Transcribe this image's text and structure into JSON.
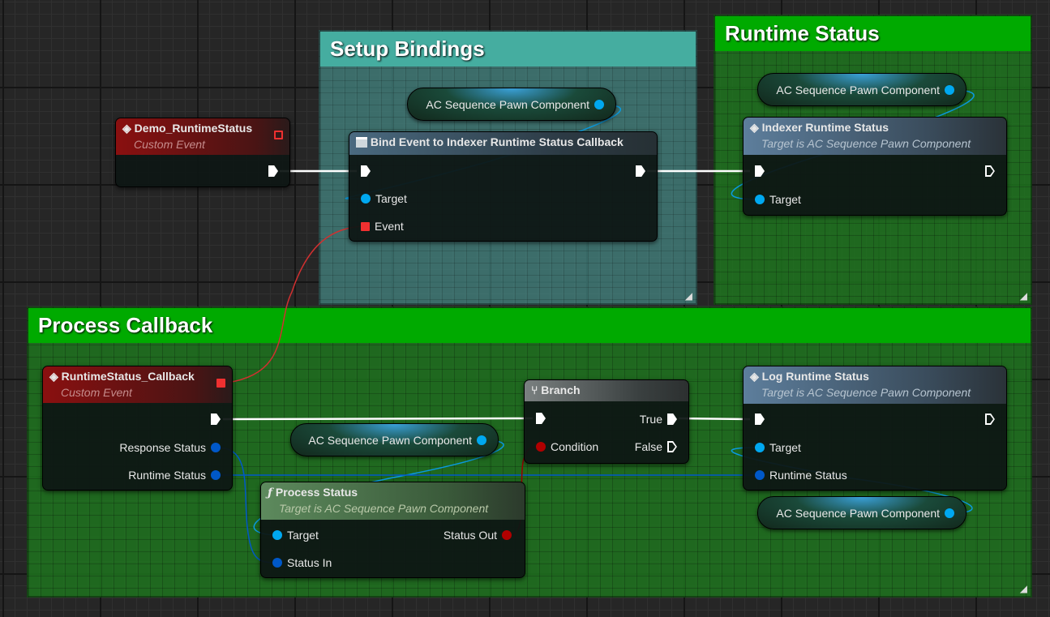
{
  "comments": {
    "setup": "Setup Bindings",
    "runtime": "Runtime Status",
    "process": "Process Callback"
  },
  "nodes": {
    "demo_event": {
      "title": "Demo_RuntimeStatus",
      "subtitle": "Custom Event"
    },
    "bind_event": {
      "title": "Bind Event to Indexer Runtime Status Callback",
      "target": "Target",
      "event": "Event"
    },
    "indexer_status": {
      "title": "Indexer Runtime Status",
      "subtitle": "Target is AC Sequence Pawn Component",
      "target": "Target"
    },
    "callback_event": {
      "title": "RuntimeStatus_Callback",
      "subtitle": "Custom Event",
      "response_status": "Response Status",
      "runtime_status": "Runtime Status"
    },
    "branch": {
      "title": "Branch",
      "condition": "Condition",
      "true": "True",
      "false": "False"
    },
    "log_status": {
      "title": "Log Runtime Status",
      "subtitle": "Target is AC Sequence Pawn Component",
      "target": "Target",
      "runtime_status": "Runtime Status"
    },
    "process_status": {
      "title": "Process Status",
      "subtitle": "Target is AC Sequence Pawn Component",
      "target": "Target",
      "status_in": "Status In",
      "status_out": "Status Out"
    }
  },
  "variables": {
    "component": "AC Sequence Pawn Component"
  },
  "colors": {
    "exec": "#ffffff",
    "object": "#00a8f0",
    "struct": "#0058c8",
    "bool": "#b00000",
    "delegate": "#f03030",
    "comment_green": "#00aa00",
    "comment_teal": "#45ada0"
  }
}
